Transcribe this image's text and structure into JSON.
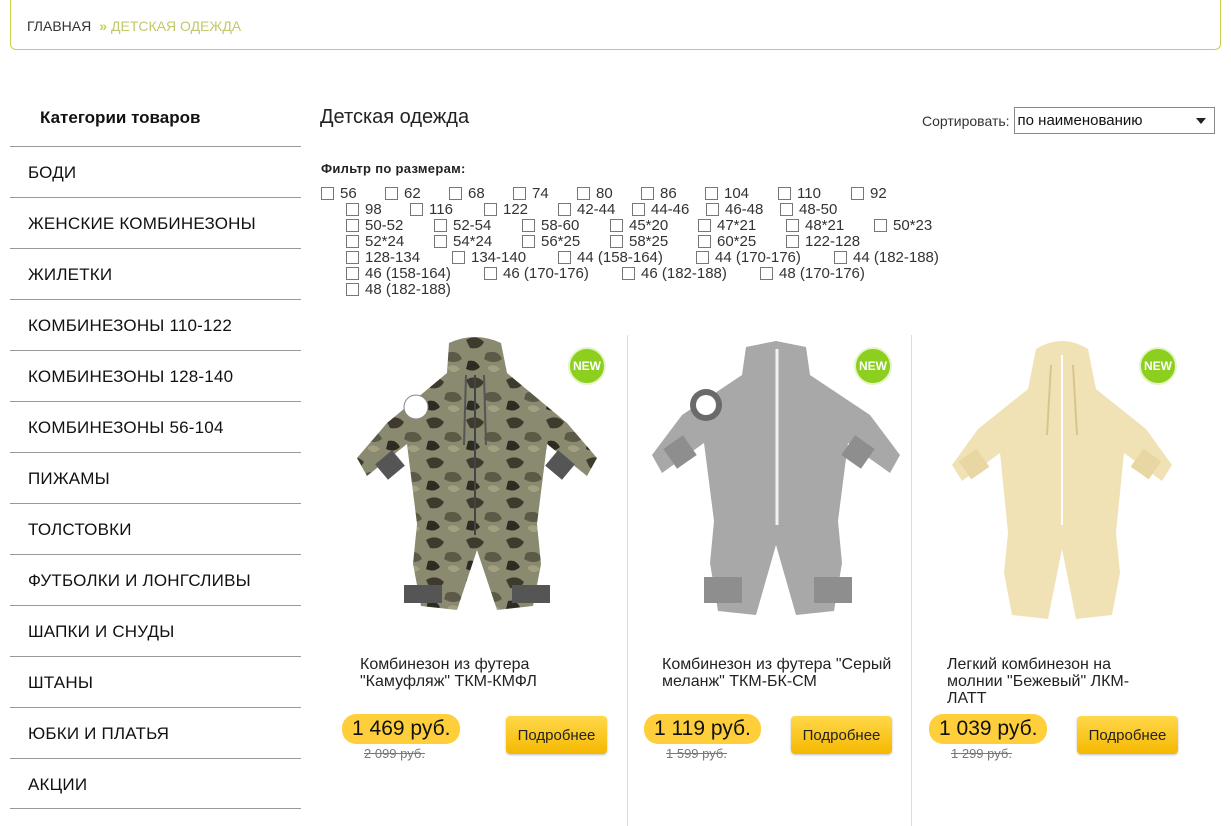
{
  "breadcrumb": {
    "home": "ГЛАВНАЯ",
    "separator": "»",
    "current": "ДЕТСКАЯ ОДЕЖДА"
  },
  "sidebar": {
    "title": "Категории товаров",
    "items": [
      "БОДИ",
      "ЖЕНСКИЕ КОМБИНЕЗОНЫ",
      "ЖИЛЕТКИ",
      "КОМБИНЕЗОНЫ 110-122",
      "КОМБИНЕЗОНЫ 128-140",
      "КОМБИНЕЗОНЫ 56-104",
      "ПИЖАМЫ",
      "ТОЛСТОВКИ",
      "ФУТБОЛКИ И ЛОНГСЛИВЫ",
      "ШАПКИ И СНУДЫ",
      "ШТАНЫ",
      "ЮБКИ И ПЛАТЬЯ",
      "АКЦИИ"
    ]
  },
  "main": {
    "title": "Детская одежда",
    "sort_label": "Сортировать:",
    "sort_value": "по наименованию"
  },
  "filter": {
    "label": "Фильтр по размерам:",
    "rows": [
      [
        "56",
        "62",
        "68",
        "74",
        "80",
        "86",
        "104",
        "110",
        "92"
      ],
      [
        "98",
        "116",
        "122",
        "42-44",
        "44-46",
        "46-48",
        "48-50"
      ],
      [
        "50-52",
        "52-54",
        "58-60",
        "45*20",
        "47*21",
        "48*21",
        "50*23"
      ],
      [
        "52*24",
        "54*24",
        "56*25",
        "58*25",
        "60*25",
        "122-128"
      ],
      [
        "128-134",
        "134-140",
        "44 (158-164)",
        "44 (170-176)",
        "44 (182-188)"
      ],
      [
        "46 (158-164)",
        "46 (170-176)",
        "46 (182-188)",
        "48 (170-176)"
      ],
      [
        "48 (182-188)"
      ]
    ]
  },
  "products": [
    {
      "name": "Комбинезон из футера \"Камуфляж\" ТКМ-КМФЛ",
      "price": "1 469 руб.",
      "old_price": "2 099 руб.",
      "badge": "NEW",
      "button": "Подробнее",
      "colors": {
        "main": "#6b6a55"
      }
    },
    {
      "name": "Комбинезон из футера \"Серый меланж\" ТКМ-БК-СМ",
      "price": "1 119 руб.",
      "old_price": "1 599 руб.",
      "badge": "NEW",
      "button": "Подробнее",
      "colors": {
        "main": "#a8a8a8"
      }
    },
    {
      "name": "Легкий комбинезон на молнии \"Бежевый\" ЛКМ-ЛАТТ",
      "price": "1 039 руб.",
      "old_price": "1 299 руб.",
      "badge": "NEW",
      "button": "Подробнее",
      "colors": {
        "main": "#f1e2b6"
      }
    }
  ],
  "colors": {
    "accent": "#c9cf4a",
    "price_bg": "#ffcf3b",
    "badge": "#8ccf1f"
  }
}
